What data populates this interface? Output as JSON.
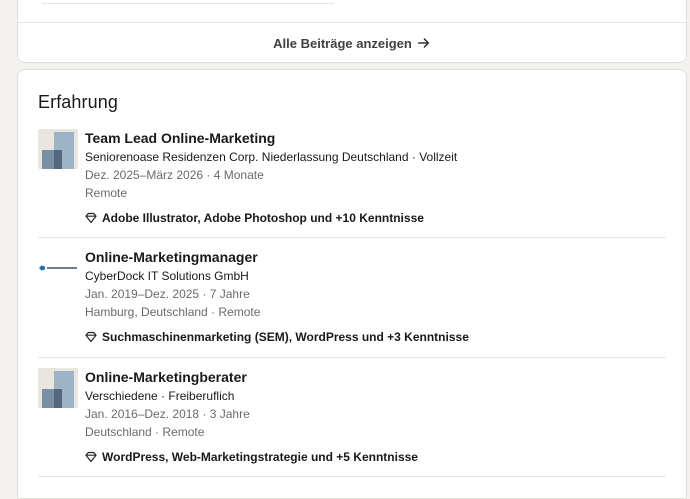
{
  "top_card": {
    "show_all_label": "Alle Beiträge anzeigen"
  },
  "experience": {
    "title": "Erfahrung",
    "items": [
      {
        "title": "Team Lead Online-Marketing",
        "company": "Seniorenoase Residenzen Corp. Niederlassung Deutschland · Vollzeit",
        "dates": "Dez. 2025–März 2026 · 4 Monate",
        "location": "Remote",
        "skills": "Adobe Illustrator, Adobe Photoshop und +10 Kenntnisse",
        "logo": "placeholder-company-logo"
      },
      {
        "title": "Online-Marketingmanager",
        "company": "CyberDock IT Solutions GmbH",
        "dates": "Jan. 2019–Dez. 2025 · 7 Jahre",
        "location": "Hamburg, Deutschland · Remote",
        "skills": "Suchmaschinenmarketing (SEM), WordPress und +3 Kenntnisse",
        "logo": "cyberdock-logo"
      },
      {
        "title": "Online-Marketingberater",
        "company": "Verschiedene · Freiberuflich",
        "dates": "Jan. 2016–Dez. 2018 · 3 Jahre",
        "location": "Deutschland · Remote",
        "skills": "WordPress, Web-Marketingstrategie und +5 Kenntnisse",
        "logo": "placeholder-company-logo"
      }
    ]
  },
  "colors": {
    "page_bg": "#f4f2ee",
    "card_bg": "#ffffff",
    "border": "#e0dfdc",
    "logo_blue": "#1d6fa8"
  }
}
